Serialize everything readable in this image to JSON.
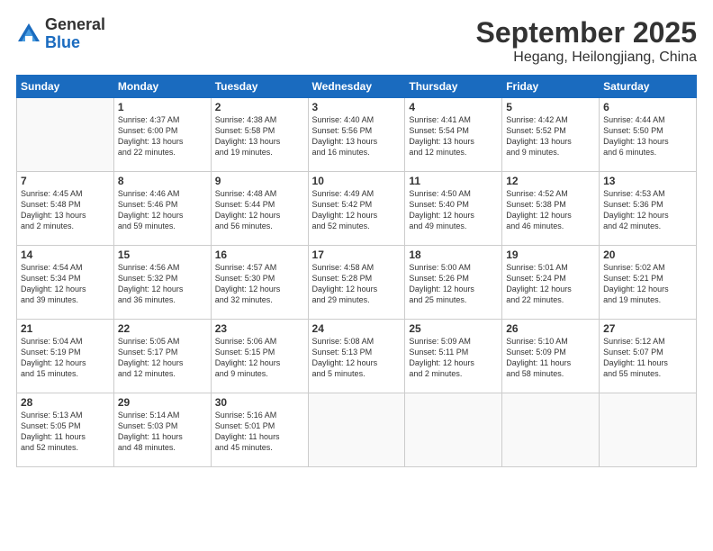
{
  "logo": {
    "general": "General",
    "blue": "Blue"
  },
  "title": "September 2025",
  "subtitle": "Hegang, Heilongjiang, China",
  "header_days": [
    "Sunday",
    "Monday",
    "Tuesday",
    "Wednesday",
    "Thursday",
    "Friday",
    "Saturday"
  ],
  "weeks": [
    [
      {
        "day": "",
        "info": ""
      },
      {
        "day": "1",
        "info": "Sunrise: 4:37 AM\nSunset: 6:00 PM\nDaylight: 13 hours\nand 22 minutes."
      },
      {
        "day": "2",
        "info": "Sunrise: 4:38 AM\nSunset: 5:58 PM\nDaylight: 13 hours\nand 19 minutes."
      },
      {
        "day": "3",
        "info": "Sunrise: 4:40 AM\nSunset: 5:56 PM\nDaylight: 13 hours\nand 16 minutes."
      },
      {
        "day": "4",
        "info": "Sunrise: 4:41 AM\nSunset: 5:54 PM\nDaylight: 13 hours\nand 12 minutes."
      },
      {
        "day": "5",
        "info": "Sunrise: 4:42 AM\nSunset: 5:52 PM\nDaylight: 13 hours\nand 9 minutes."
      },
      {
        "day": "6",
        "info": "Sunrise: 4:44 AM\nSunset: 5:50 PM\nDaylight: 13 hours\nand 6 minutes."
      }
    ],
    [
      {
        "day": "7",
        "info": "Sunrise: 4:45 AM\nSunset: 5:48 PM\nDaylight: 13 hours\nand 2 minutes."
      },
      {
        "day": "8",
        "info": "Sunrise: 4:46 AM\nSunset: 5:46 PM\nDaylight: 12 hours\nand 59 minutes."
      },
      {
        "day": "9",
        "info": "Sunrise: 4:48 AM\nSunset: 5:44 PM\nDaylight: 12 hours\nand 56 minutes."
      },
      {
        "day": "10",
        "info": "Sunrise: 4:49 AM\nSunset: 5:42 PM\nDaylight: 12 hours\nand 52 minutes."
      },
      {
        "day": "11",
        "info": "Sunrise: 4:50 AM\nSunset: 5:40 PM\nDaylight: 12 hours\nand 49 minutes."
      },
      {
        "day": "12",
        "info": "Sunrise: 4:52 AM\nSunset: 5:38 PM\nDaylight: 12 hours\nand 46 minutes."
      },
      {
        "day": "13",
        "info": "Sunrise: 4:53 AM\nSunset: 5:36 PM\nDaylight: 12 hours\nand 42 minutes."
      }
    ],
    [
      {
        "day": "14",
        "info": "Sunrise: 4:54 AM\nSunset: 5:34 PM\nDaylight: 12 hours\nand 39 minutes."
      },
      {
        "day": "15",
        "info": "Sunrise: 4:56 AM\nSunset: 5:32 PM\nDaylight: 12 hours\nand 36 minutes."
      },
      {
        "day": "16",
        "info": "Sunrise: 4:57 AM\nSunset: 5:30 PM\nDaylight: 12 hours\nand 32 minutes."
      },
      {
        "day": "17",
        "info": "Sunrise: 4:58 AM\nSunset: 5:28 PM\nDaylight: 12 hours\nand 29 minutes."
      },
      {
        "day": "18",
        "info": "Sunrise: 5:00 AM\nSunset: 5:26 PM\nDaylight: 12 hours\nand 25 minutes."
      },
      {
        "day": "19",
        "info": "Sunrise: 5:01 AM\nSunset: 5:24 PM\nDaylight: 12 hours\nand 22 minutes."
      },
      {
        "day": "20",
        "info": "Sunrise: 5:02 AM\nSunset: 5:21 PM\nDaylight: 12 hours\nand 19 minutes."
      }
    ],
    [
      {
        "day": "21",
        "info": "Sunrise: 5:04 AM\nSunset: 5:19 PM\nDaylight: 12 hours\nand 15 minutes."
      },
      {
        "day": "22",
        "info": "Sunrise: 5:05 AM\nSunset: 5:17 PM\nDaylight: 12 hours\nand 12 minutes."
      },
      {
        "day": "23",
        "info": "Sunrise: 5:06 AM\nSunset: 5:15 PM\nDaylight: 12 hours\nand 9 minutes."
      },
      {
        "day": "24",
        "info": "Sunrise: 5:08 AM\nSunset: 5:13 PM\nDaylight: 12 hours\nand 5 minutes."
      },
      {
        "day": "25",
        "info": "Sunrise: 5:09 AM\nSunset: 5:11 PM\nDaylight: 12 hours\nand 2 minutes."
      },
      {
        "day": "26",
        "info": "Sunrise: 5:10 AM\nSunset: 5:09 PM\nDaylight: 11 hours\nand 58 minutes."
      },
      {
        "day": "27",
        "info": "Sunrise: 5:12 AM\nSunset: 5:07 PM\nDaylight: 11 hours\nand 55 minutes."
      }
    ],
    [
      {
        "day": "28",
        "info": "Sunrise: 5:13 AM\nSunset: 5:05 PM\nDaylight: 11 hours\nand 52 minutes."
      },
      {
        "day": "29",
        "info": "Sunrise: 5:14 AM\nSunset: 5:03 PM\nDaylight: 11 hours\nand 48 minutes."
      },
      {
        "day": "30",
        "info": "Sunrise: 5:16 AM\nSunset: 5:01 PM\nDaylight: 11 hours\nand 45 minutes."
      },
      {
        "day": "",
        "info": ""
      },
      {
        "day": "",
        "info": ""
      },
      {
        "day": "",
        "info": ""
      },
      {
        "day": "",
        "info": ""
      }
    ]
  ]
}
